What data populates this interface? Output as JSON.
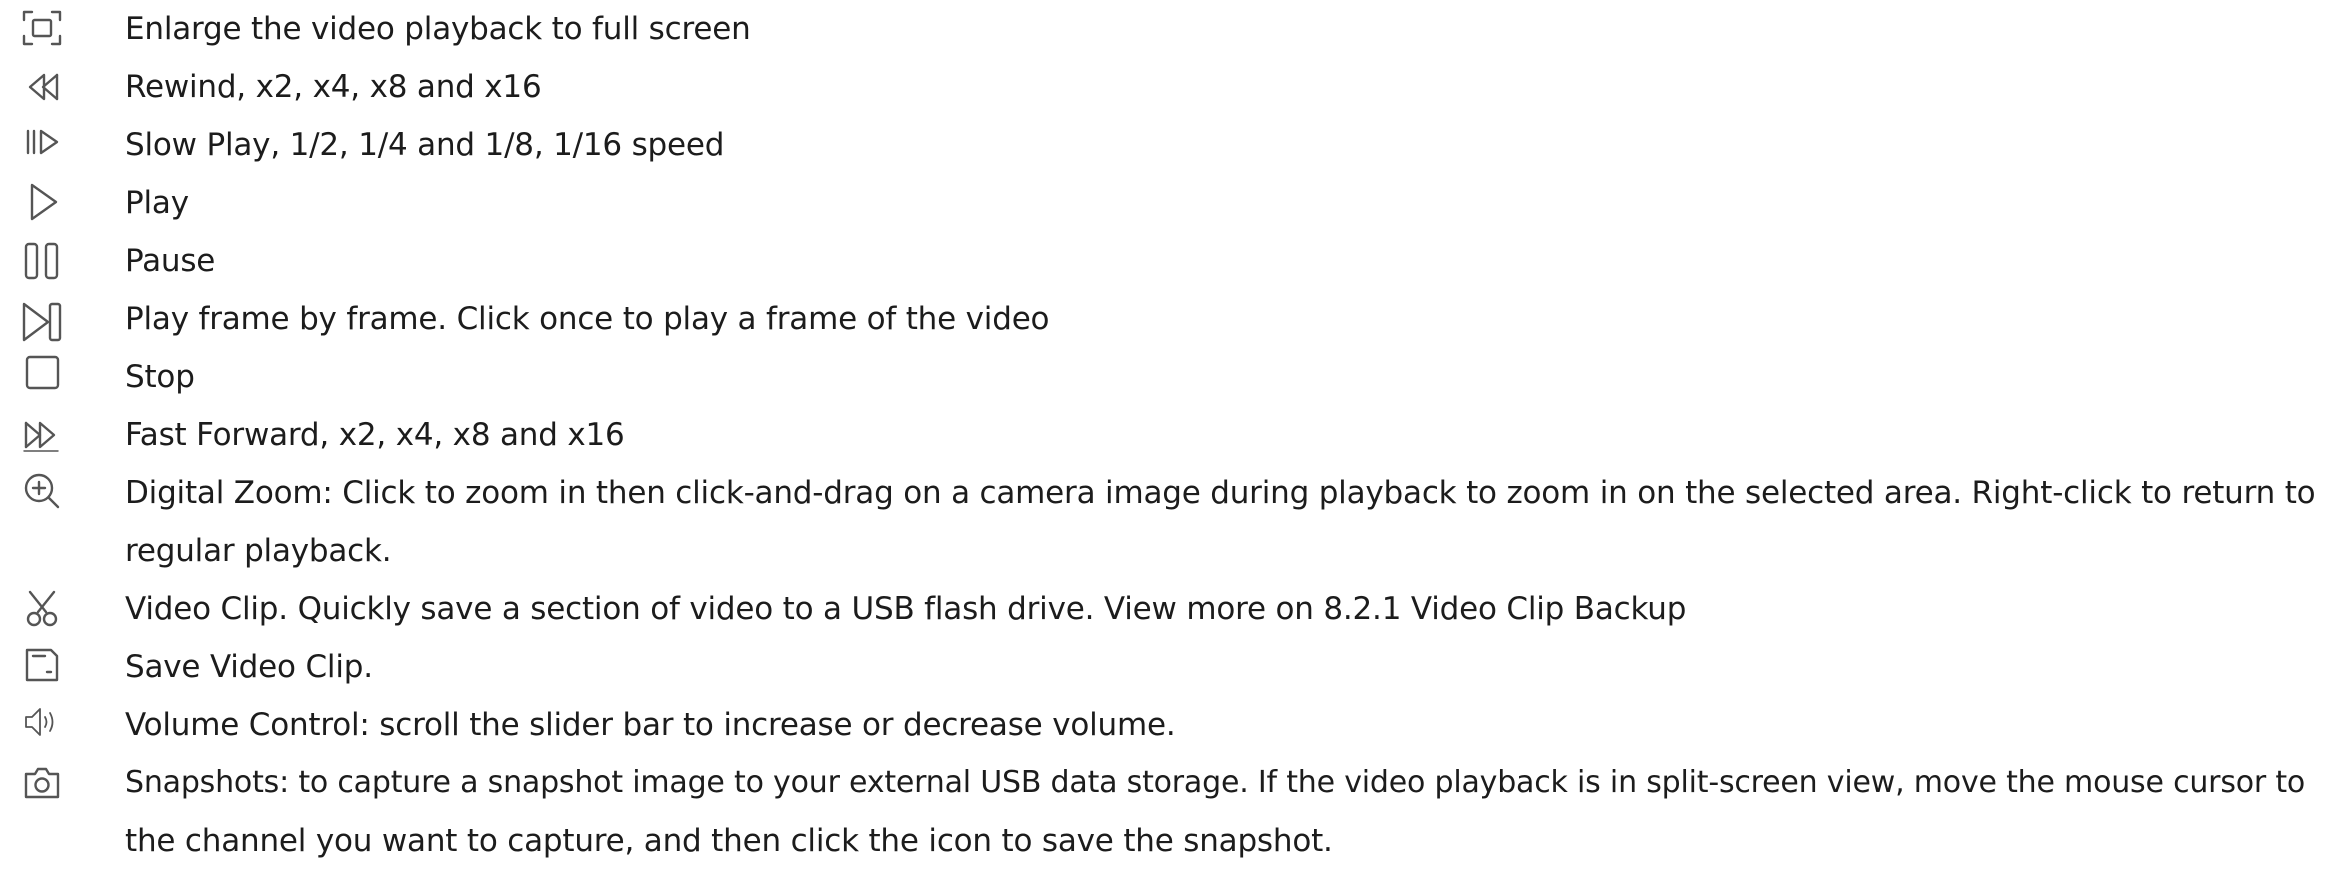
{
  "legend": {
    "items": [
      {
        "icon": "fullscreen-icon",
        "text": "Enlarge the video playback to full screen"
      },
      {
        "icon": "rewind-icon",
        "text": "Rewind, x2, x4, x8 and x16"
      },
      {
        "icon": "slow-play-icon",
        "text": "Slow Play, 1/2, 1/4 and 1/8, 1/16 speed"
      },
      {
        "icon": "play-icon",
        "text": "Play"
      },
      {
        "icon": "pause-icon",
        "text": "Pause"
      },
      {
        "icon": "frame-step-icon",
        "text": "Play frame by frame. Click once to play a frame of the video"
      },
      {
        "icon": "stop-icon",
        "text": "Stop"
      },
      {
        "icon": "fast-forward-icon",
        "text": "Fast Forward, x2, x4, x8 and x16"
      },
      {
        "icon": "zoom-in-icon",
        "text": "Digital Zoom: Click to zoom in then click-and-drag on a camera image during playback to zoom in on the selected area. Right-click to return to",
        "text2": "regular playback."
      },
      {
        "icon": "scissors-icon",
        "text": "Video Clip. Quickly save a section of video to a USB flash drive. View more on 8.2.1 Video Clip Backup"
      },
      {
        "icon": "save-icon",
        "text": "Save Video Clip."
      },
      {
        "icon": "volume-icon",
        "text": "Volume Control: scroll the slider bar to increase or decrease volume."
      },
      {
        "icon": "camera-icon",
        "text": "Snapshots: to capture a snapshot image to your external USB data storage. If the video playback is in split-screen view, move the mouse cursor to",
        "text2": "the channel you want to capture, and then click the icon to save the snapshot."
      }
    ]
  }
}
